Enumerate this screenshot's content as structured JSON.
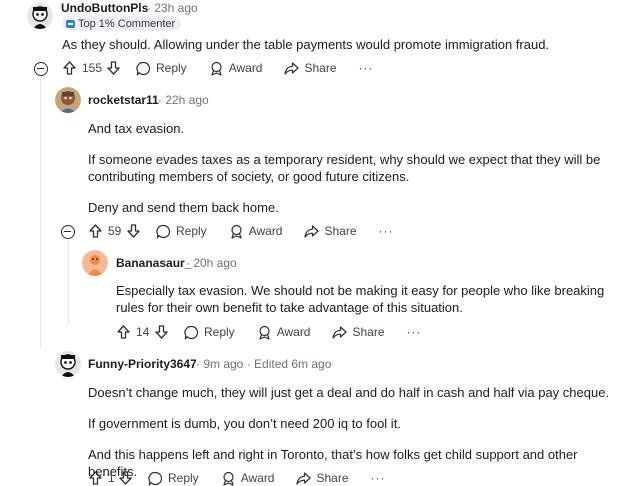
{
  "comments": [
    {
      "author": "UndoButtonPls",
      "time": "· 23h ago",
      "flair": "Top 1% Commenter",
      "paragraphs": [
        "As they should. Allowing under the table payments would promote immigration fraud."
      ],
      "votes": "155",
      "actions": {
        "reply": "Reply",
        "award": "Award",
        "share": "Share",
        "more": "···"
      }
    },
    {
      "author": "rocketstar11",
      "time": "· 22h ago",
      "paragraphs": [
        "And tax evasion.",
        "If someone evades taxes as a temporary resident, why should we expect that they will be contributing members of society, or good future citizens.",
        "Deny and send them back home."
      ],
      "votes": "59",
      "actions": {
        "reply": "Reply",
        "award": "Award",
        "share": "Share",
        "more": "···"
      }
    },
    {
      "author": "Bananasaur_",
      "time": "· 20h ago",
      "paragraphs": [
        "Especially tax evasion. We should not be making it easy for people who like breaking rules for their own benefit to take advantage of this situation."
      ],
      "votes": "14",
      "actions": {
        "reply": "Reply",
        "award": "Award",
        "share": "Share",
        "more": "···"
      }
    },
    {
      "author": "Funny-Priority3647",
      "time": "· 9m ago · Edited 6m ago",
      "paragraphs": [
        "Doesn’t change much, they will just get a deal and do half in cash and half via pay cheque.",
        "If government is dumb, you don’t need 200 iq to fool it.",
        "And this happens left and right in Toronto, that’s how folks get child support and other benefits."
      ],
      "votes": "1",
      "actions": {
        "reply": "Reply",
        "award": "Award",
        "share": "Share",
        "more": "···"
      }
    }
  ],
  "icons": {
    "upvote": "arrow-up-icon",
    "downvote": "arrow-down-icon",
    "reply": "speech-bubble-icon",
    "award": "award-icon",
    "share": "share-arrow-icon",
    "collapse": "minus-circle-icon",
    "flair": "badge-icon"
  },
  "colors": {
    "text": "#1c1c1c",
    "meta": "#6b7280",
    "flair_bg": "#eef0f3",
    "flair_icon": "#2f7fd4",
    "avatar_orange": "#f08a4b"
  }
}
